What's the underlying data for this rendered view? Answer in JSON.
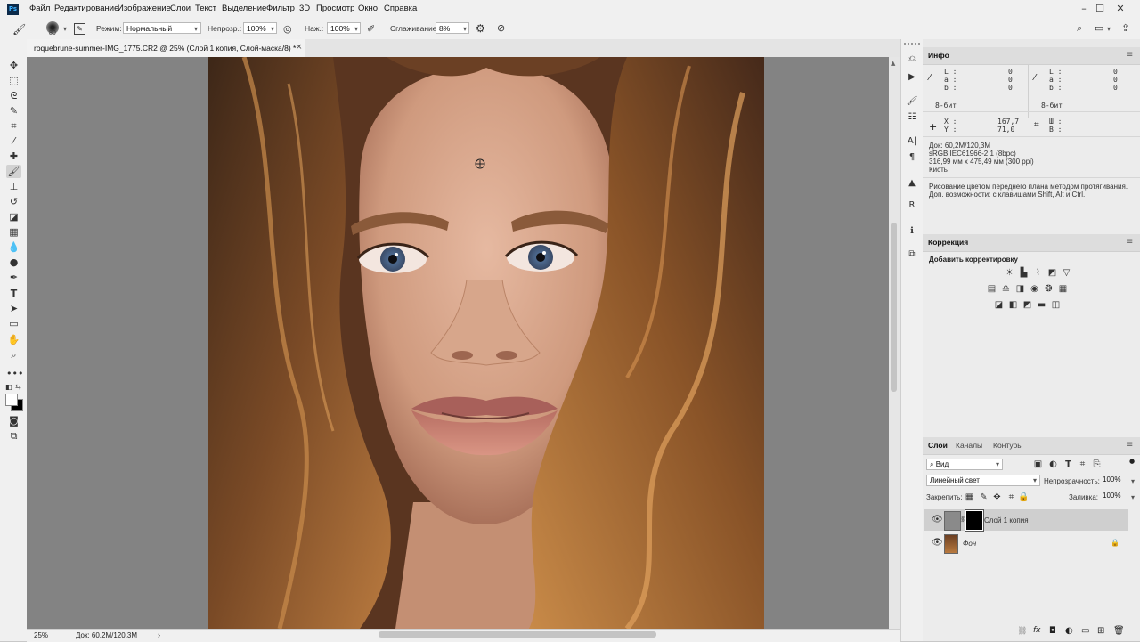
{
  "app": {
    "logo_text": "Ps"
  },
  "menu": [
    "Файл",
    "Редактирование",
    "Изображение",
    "Слои",
    "Текст",
    "Выделение",
    "Фильтр",
    "3D",
    "Просмотр",
    "Окно",
    "Справка"
  ],
  "options": {
    "brush_size": "80",
    "mode_label": "Режим:",
    "mode_value": "Нормальный",
    "opacity_label": "Непрозр.:",
    "opacity_value": "100%",
    "flow_label": "Наж.:",
    "flow_value": "100%",
    "smoothing_label": "Сглаживание:",
    "smoothing_value": "8%"
  },
  "document": {
    "tab_title": "roquebrune-summer-IMG_1775.CR2 @ 25% (Слой 1 копия, Слой-маска/8) *",
    "close": "×"
  },
  "status": {
    "zoom": "25%",
    "doc": "Док: 60,2M/120,3M",
    "arrow": "›"
  },
  "info_panel": {
    "title": "Инфо",
    "left": {
      "L": "0",
      "a": "0",
      "b": "0"
    },
    "right": {
      "L": "0",
      "a": "0",
      "b": "0"
    },
    "bits_left": "8-бит",
    "bits_right": "8-бит",
    "x_label": "X :",
    "x_value": "167,7",
    "y_label": "Y :",
    "y_value": "71,0",
    "w_label": "Ш :",
    "h_label": "В :",
    "lines": [
      "Док: 60,2M/120,3M",
      "sRGB IEC61966-2.1 (8bpc)",
      "316,99 мм x 475,49 мм (300 ppi)",
      "Кисть"
    ],
    "hint": [
      "Рисование цветом переднего плана методом протягивания.",
      "Доп. возможности: с клавишами Shift, Alt и Ctrl."
    ]
  },
  "correction_panel": {
    "title": "Коррекция",
    "subtitle": "Добавить корректировку"
  },
  "layers_panel": {
    "tabs": [
      "Слои",
      "Каналы",
      "Контуры"
    ],
    "filter_value": "Вид",
    "blend_value": "Линейный свет",
    "opacity_label": "Непрозрачность:",
    "opacity_value": "100%",
    "lock_label": "Закрепить:",
    "fill_label": "Заливка:",
    "fill_value": "100%",
    "layers": [
      {
        "name": "Слой 1 копия",
        "selected": true
      },
      {
        "name": "Фон",
        "selected": false,
        "locked": true
      }
    ]
  },
  "colors": {
    "accent_selected": "#cfcfcf",
    "ps_blue": "#3ab0ff"
  }
}
